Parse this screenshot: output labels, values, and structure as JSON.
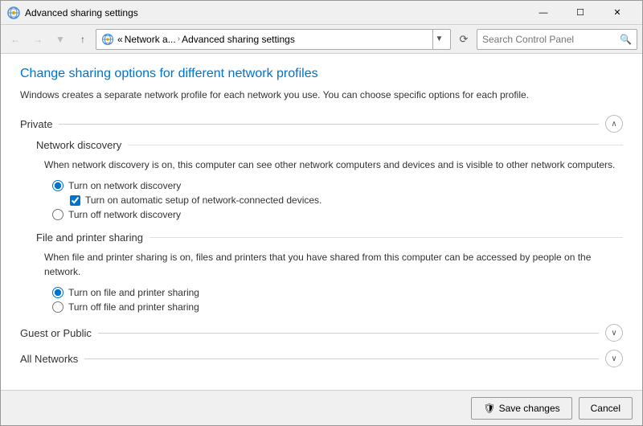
{
  "window": {
    "title": "Advanced sharing settings",
    "controls": {
      "minimize": "—",
      "maximize": "☐",
      "close": "✕"
    }
  },
  "addressbar": {
    "back_tooltip": "Back",
    "forward_tooltip": "Forward",
    "up_tooltip": "Up",
    "path_prefix": "«",
    "path_part1": "Network a...",
    "path_chevron": "›",
    "path_part2": "Advanced sharing settings",
    "refresh_label": "⟳",
    "search_placeholder": "Search Control Panel"
  },
  "page": {
    "heading": "Change sharing options for different network profiles",
    "description": "Windows creates a separate network profile for each network you use. You can choose specific options for each profile."
  },
  "sections": [
    {
      "id": "private",
      "title": "Private",
      "expanded": true,
      "toggle_icon": "∧",
      "subsections": [
        {
          "id": "network-discovery",
          "title": "Network discovery",
          "description": "When network discovery is on, this computer can see other network computers and devices and is visible to other network computers.",
          "options": [
            {
              "id": "nd-on",
              "type": "radio",
              "name": "network_discovery",
              "checked": true,
              "label": "Turn on network discovery",
              "sub_options": [
                {
                  "id": "nd-auto",
                  "type": "checkbox",
                  "checked": true,
                  "label": "Turn on automatic setup of network-connected devices."
                }
              ]
            },
            {
              "id": "nd-off",
              "type": "radio",
              "name": "network_discovery",
              "checked": false,
              "label": "Turn off network discovery"
            }
          ]
        },
        {
          "id": "file-printer-sharing",
          "title": "File and printer sharing",
          "description": "When file and printer sharing is on, files and printers that you have shared from this computer can be accessed by people on the network.",
          "options": [
            {
              "id": "fps-on",
              "type": "radio",
              "name": "file_printer",
              "checked": true,
              "label": "Turn on file and printer sharing"
            },
            {
              "id": "fps-off",
              "type": "radio",
              "name": "file_printer",
              "checked": false,
              "label": "Turn off file and printer sharing"
            }
          ]
        }
      ]
    },
    {
      "id": "guest-public",
      "title": "Guest or Public",
      "expanded": false,
      "toggle_icon": "∨"
    },
    {
      "id": "all-networks",
      "title": "All Networks",
      "expanded": false,
      "toggle_icon": "∨"
    }
  ],
  "footer": {
    "save_label": "Save changes",
    "cancel_label": "Cancel",
    "save_icon": "🛡"
  }
}
